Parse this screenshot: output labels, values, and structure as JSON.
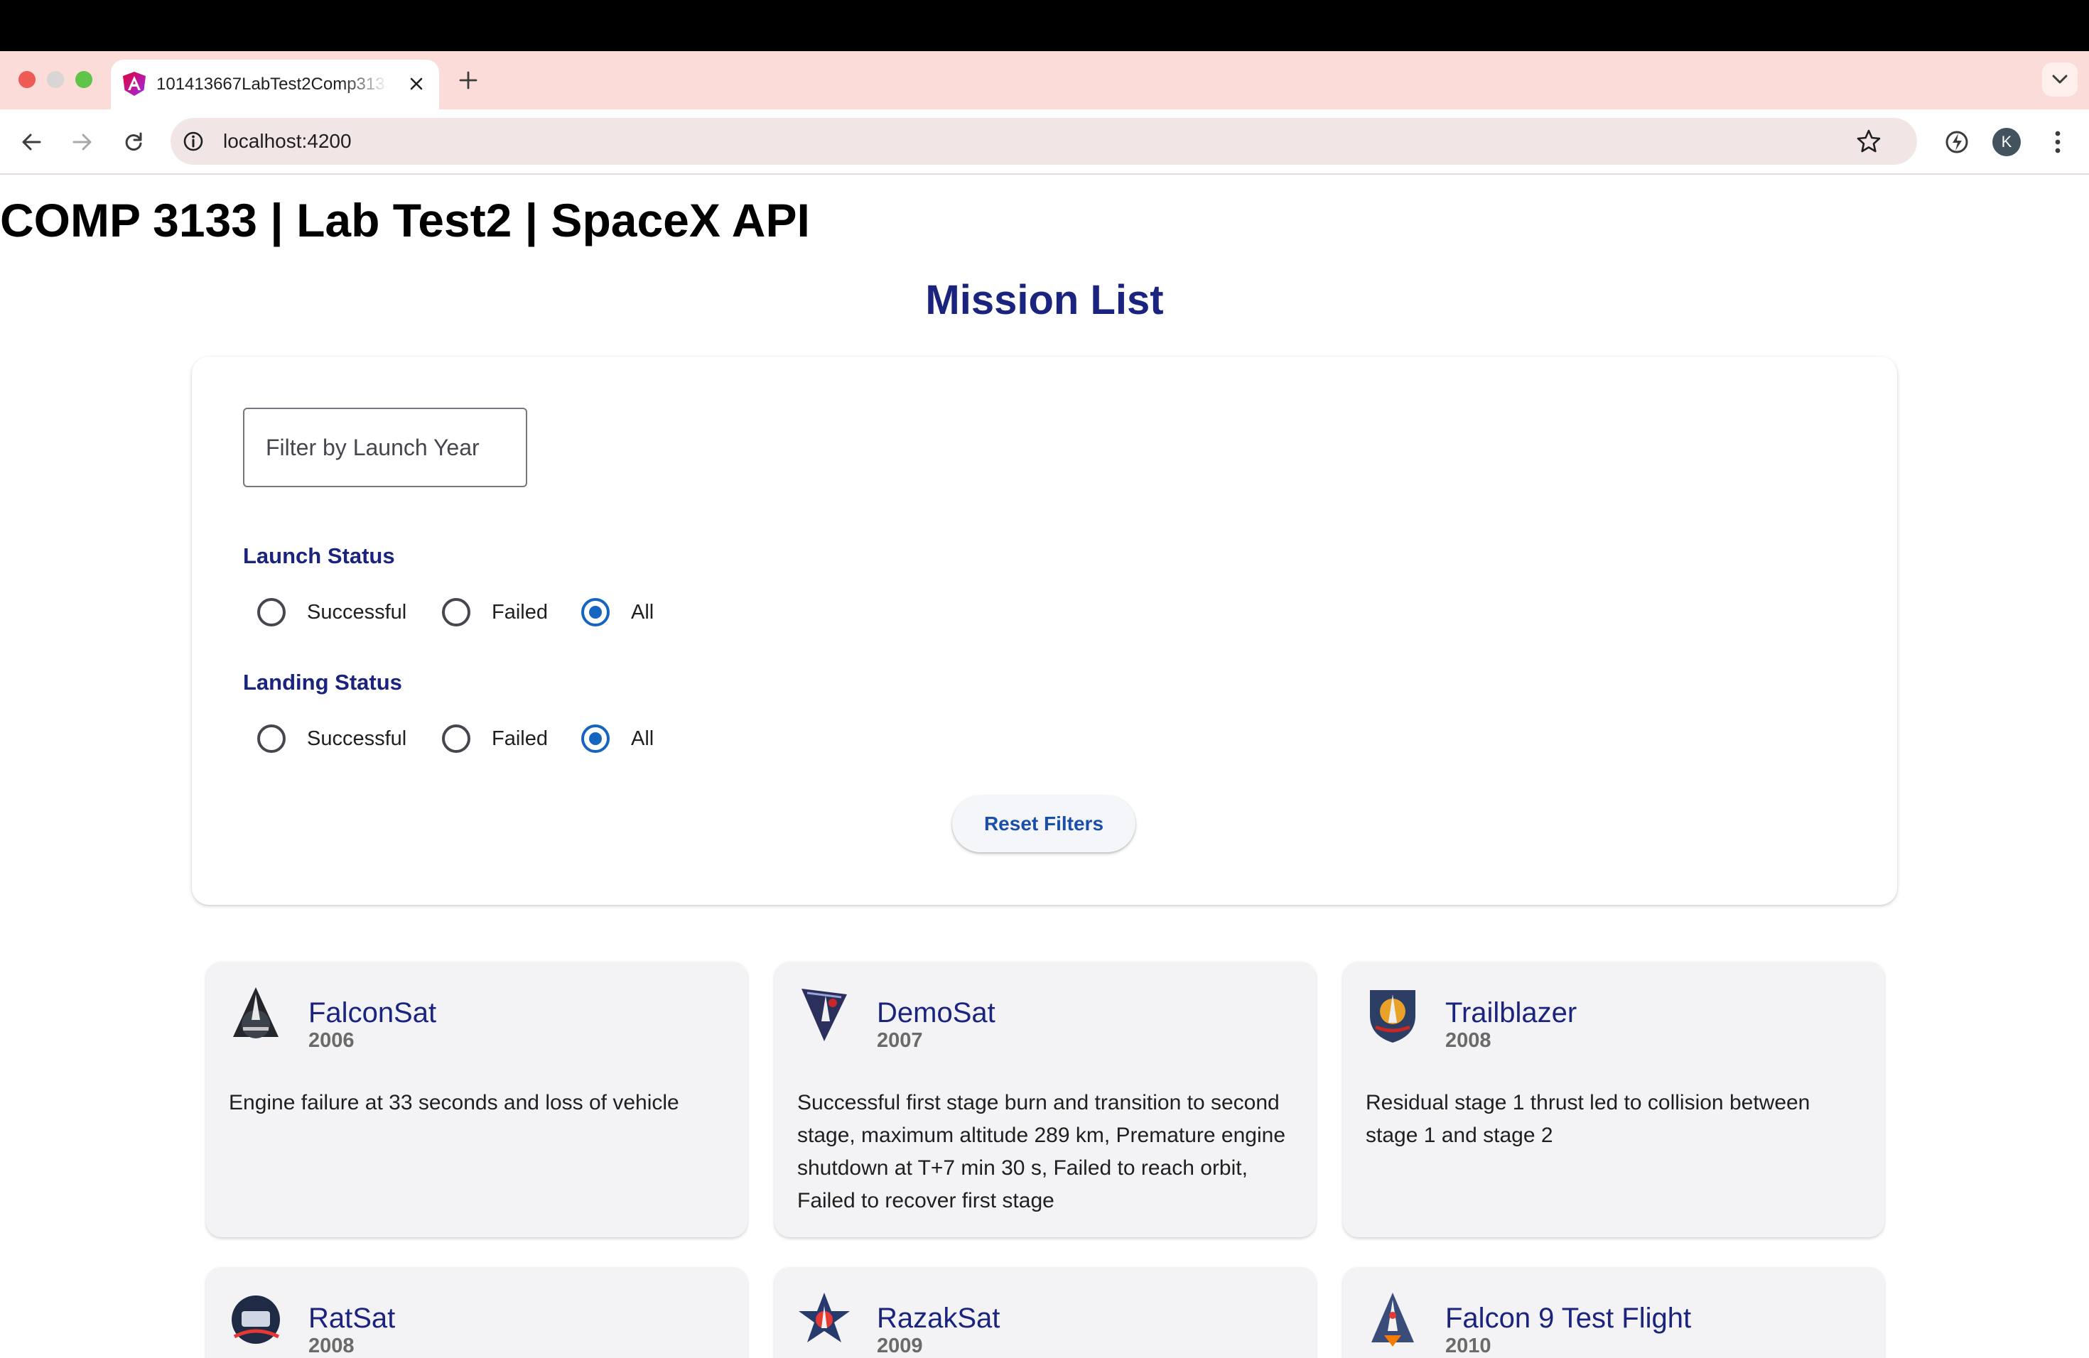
{
  "browser": {
    "tab_title": "101413667LabTest2Comp3133",
    "url": "localhost:4200",
    "profile_initial": "K",
    "icons": {
      "favicon": "angular-icon",
      "tab_close": "close-icon",
      "new_tab": "plus-icon",
      "tab_search": "chevron-down-icon",
      "back": "back-arrow-icon",
      "forward": "forward-arrow-icon",
      "reload": "reload-icon",
      "site_info": "info-icon",
      "bookmark": "star-icon",
      "extension": "extension-icon",
      "menu": "kebab-menu-icon"
    }
  },
  "page": {
    "title": "COMP 3133 | Lab Test2 | SpaceX API",
    "heading": "Mission List"
  },
  "filters": {
    "year_placeholder": "Filter by Launch Year",
    "year_value": "",
    "launch_status": {
      "label": "Launch Status",
      "options": [
        "Successful",
        "Failed",
        "All"
      ],
      "selected": "All"
    },
    "landing_status": {
      "label": "Landing Status",
      "options": [
        "Successful",
        "Failed",
        "All"
      ],
      "selected": "All"
    },
    "reset_label": "Reset Filters"
  },
  "missions": [
    {
      "name": "FalconSat",
      "year": "2006",
      "details": "Engine failure at 33 seconds and loss of vehicle",
      "patch_icon": "mission-patch-icon"
    },
    {
      "name": "DemoSat",
      "year": "2007",
      "details": "Successful first stage burn and transition to second stage, maximum altitude 289 km, Premature engine shutdown at T+7 min 30 s, Failed to reach orbit, Failed to recover first stage",
      "patch_icon": "mission-patch-icon"
    },
    {
      "name": "Trailblazer",
      "year": "2008",
      "details": "Residual stage 1 thrust led to collision between stage 1 and stage 2",
      "patch_icon": "mission-patch-icon"
    },
    {
      "name": "RatSat",
      "year": "2008",
      "details": "",
      "patch_icon": "mission-patch-icon"
    },
    {
      "name": "RazakSat",
      "year": "2009",
      "details": "",
      "patch_icon": "mission-patch-icon"
    },
    {
      "name": "Falcon 9 Test Flight",
      "year": "2010",
      "details": "",
      "patch_icon": "mission-patch-icon"
    }
  ],
  "colors": {
    "primary": "#1a237e",
    "accent": "#1565c0",
    "tabstrip": "#fbdcd8",
    "card_bg": "#f3f3f5"
  }
}
